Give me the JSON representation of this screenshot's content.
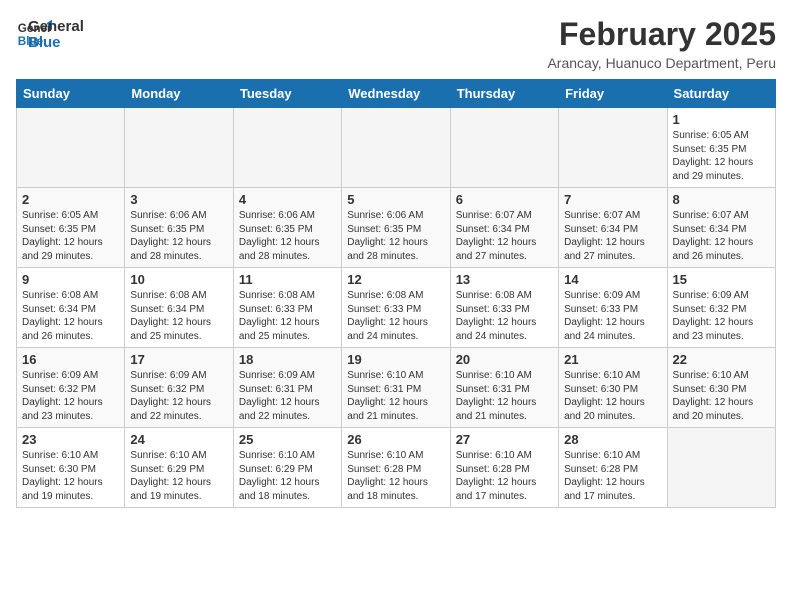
{
  "logo": {
    "line1": "General",
    "line2": "Blue"
  },
  "title": "February 2025",
  "location": "Arancay, Huanuco Department, Peru",
  "weekdays": [
    "Sunday",
    "Monday",
    "Tuesday",
    "Wednesday",
    "Thursday",
    "Friday",
    "Saturday"
  ],
  "weeks": [
    [
      {
        "day": "",
        "info": ""
      },
      {
        "day": "",
        "info": ""
      },
      {
        "day": "",
        "info": ""
      },
      {
        "day": "",
        "info": ""
      },
      {
        "day": "",
        "info": ""
      },
      {
        "day": "",
        "info": ""
      },
      {
        "day": "1",
        "info": "Sunrise: 6:05 AM\nSunset: 6:35 PM\nDaylight: 12 hours and 29 minutes."
      }
    ],
    [
      {
        "day": "2",
        "info": "Sunrise: 6:05 AM\nSunset: 6:35 PM\nDaylight: 12 hours and 29 minutes."
      },
      {
        "day": "3",
        "info": "Sunrise: 6:06 AM\nSunset: 6:35 PM\nDaylight: 12 hours and 28 minutes."
      },
      {
        "day": "4",
        "info": "Sunrise: 6:06 AM\nSunset: 6:35 PM\nDaylight: 12 hours and 28 minutes."
      },
      {
        "day": "5",
        "info": "Sunrise: 6:06 AM\nSunset: 6:35 PM\nDaylight: 12 hours and 28 minutes."
      },
      {
        "day": "6",
        "info": "Sunrise: 6:07 AM\nSunset: 6:34 PM\nDaylight: 12 hours and 27 minutes."
      },
      {
        "day": "7",
        "info": "Sunrise: 6:07 AM\nSunset: 6:34 PM\nDaylight: 12 hours and 27 minutes."
      },
      {
        "day": "8",
        "info": "Sunrise: 6:07 AM\nSunset: 6:34 PM\nDaylight: 12 hours and 26 minutes."
      }
    ],
    [
      {
        "day": "9",
        "info": "Sunrise: 6:08 AM\nSunset: 6:34 PM\nDaylight: 12 hours and 26 minutes."
      },
      {
        "day": "10",
        "info": "Sunrise: 6:08 AM\nSunset: 6:34 PM\nDaylight: 12 hours and 25 minutes."
      },
      {
        "day": "11",
        "info": "Sunrise: 6:08 AM\nSunset: 6:33 PM\nDaylight: 12 hours and 25 minutes."
      },
      {
        "day": "12",
        "info": "Sunrise: 6:08 AM\nSunset: 6:33 PM\nDaylight: 12 hours and 24 minutes."
      },
      {
        "day": "13",
        "info": "Sunrise: 6:08 AM\nSunset: 6:33 PM\nDaylight: 12 hours and 24 minutes."
      },
      {
        "day": "14",
        "info": "Sunrise: 6:09 AM\nSunset: 6:33 PM\nDaylight: 12 hours and 24 minutes."
      },
      {
        "day": "15",
        "info": "Sunrise: 6:09 AM\nSunset: 6:32 PM\nDaylight: 12 hours and 23 minutes."
      }
    ],
    [
      {
        "day": "16",
        "info": "Sunrise: 6:09 AM\nSunset: 6:32 PM\nDaylight: 12 hours and 23 minutes."
      },
      {
        "day": "17",
        "info": "Sunrise: 6:09 AM\nSunset: 6:32 PM\nDaylight: 12 hours and 22 minutes."
      },
      {
        "day": "18",
        "info": "Sunrise: 6:09 AM\nSunset: 6:31 PM\nDaylight: 12 hours and 22 minutes."
      },
      {
        "day": "19",
        "info": "Sunrise: 6:10 AM\nSunset: 6:31 PM\nDaylight: 12 hours and 21 minutes."
      },
      {
        "day": "20",
        "info": "Sunrise: 6:10 AM\nSunset: 6:31 PM\nDaylight: 12 hours and 21 minutes."
      },
      {
        "day": "21",
        "info": "Sunrise: 6:10 AM\nSunset: 6:30 PM\nDaylight: 12 hours and 20 minutes."
      },
      {
        "day": "22",
        "info": "Sunrise: 6:10 AM\nSunset: 6:30 PM\nDaylight: 12 hours and 20 minutes."
      }
    ],
    [
      {
        "day": "23",
        "info": "Sunrise: 6:10 AM\nSunset: 6:30 PM\nDaylight: 12 hours and 19 minutes."
      },
      {
        "day": "24",
        "info": "Sunrise: 6:10 AM\nSunset: 6:29 PM\nDaylight: 12 hours and 19 minutes."
      },
      {
        "day": "25",
        "info": "Sunrise: 6:10 AM\nSunset: 6:29 PM\nDaylight: 12 hours and 18 minutes."
      },
      {
        "day": "26",
        "info": "Sunrise: 6:10 AM\nSunset: 6:28 PM\nDaylight: 12 hours and 18 minutes."
      },
      {
        "day": "27",
        "info": "Sunrise: 6:10 AM\nSunset: 6:28 PM\nDaylight: 12 hours and 17 minutes."
      },
      {
        "day": "28",
        "info": "Sunrise: 6:10 AM\nSunset: 6:28 PM\nDaylight: 12 hours and 17 minutes."
      },
      {
        "day": "",
        "info": ""
      }
    ]
  ]
}
